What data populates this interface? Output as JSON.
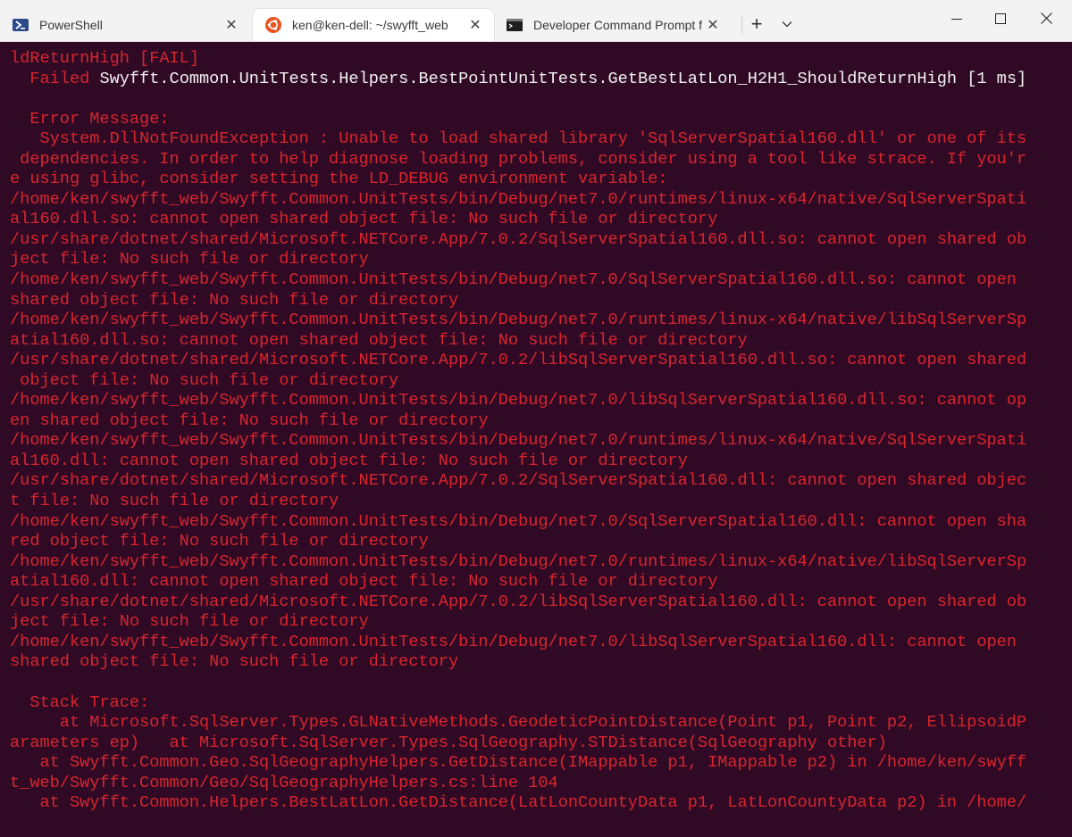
{
  "tabs": [
    {
      "label": "PowerShell",
      "icon": "powershell-icon",
      "active": false
    },
    {
      "label": "ken@ken-dell: ~/swyfft_web",
      "icon": "ubuntu-icon",
      "active": true
    },
    {
      "label": "Developer Command Prompt f",
      "icon": "cmd-icon",
      "active": false
    }
  ],
  "toolbar": {
    "new_tab": "+",
    "dropdown": "⌄"
  },
  "window": {
    "minimize": "—",
    "maximize": "☐",
    "close": "✕"
  },
  "colors": {
    "terminal_bg": "#300a24",
    "error_red": "#d9252e",
    "bright_text": "#f2f2f2",
    "ubuntu_orange": "#e95420"
  },
  "terminal": {
    "lines": [
      {
        "text": "ldReturnHigh [FAIL]"
      },
      {
        "prefix": "  Failed ",
        "text": "Swyfft.Common.UnitTests.Helpers.BestPointUnitTests.GetBestLatLon_H2H1_ShouldReturnHigh [1 ms]",
        "bright": true
      },
      {
        "text": ""
      },
      {
        "text": "  Error Message:"
      },
      {
        "text": "   System.DllNotFoundException : Unable to load shared library 'SqlServerSpatial160.dll' or one of its"
      },
      {
        "text": " dependencies. In order to help diagnose loading problems, consider using a tool like strace. If you'r"
      },
      {
        "text": "e using glibc, consider setting the LD_DEBUG environment variable:"
      },
      {
        "text": "/home/ken/swyfft_web/Swyfft.Common.UnitTests/bin/Debug/net7.0/runtimes/linux-x64/native/SqlServerSpati"
      },
      {
        "text": "al160.dll.so: cannot open shared object file: No such file or directory"
      },
      {
        "text": "/usr/share/dotnet/shared/Microsoft.NETCore.App/7.0.2/SqlServerSpatial160.dll.so: cannot open shared ob"
      },
      {
        "text": "ject file: No such file or directory"
      },
      {
        "text": "/home/ken/swyfft_web/Swyfft.Common.UnitTests/bin/Debug/net7.0/SqlServerSpatial160.dll.so: cannot open"
      },
      {
        "text": "shared object file: No such file or directory"
      },
      {
        "text": "/home/ken/swyfft_web/Swyfft.Common.UnitTests/bin/Debug/net7.0/runtimes/linux-x64/native/libSqlServerSp"
      },
      {
        "text": "atial160.dll.so: cannot open shared object file: No such file or directory"
      },
      {
        "text": "/usr/share/dotnet/shared/Microsoft.NETCore.App/7.0.2/libSqlServerSpatial160.dll.so: cannot open shared"
      },
      {
        "text": " object file: No such file or directory"
      },
      {
        "text": "/home/ken/swyfft_web/Swyfft.Common.UnitTests/bin/Debug/net7.0/libSqlServerSpatial160.dll.so: cannot op"
      },
      {
        "text": "en shared object file: No such file or directory"
      },
      {
        "text": "/home/ken/swyfft_web/Swyfft.Common.UnitTests/bin/Debug/net7.0/runtimes/linux-x64/native/SqlServerSpati"
      },
      {
        "text": "al160.dll: cannot open shared object file: No such file or directory"
      },
      {
        "text": "/usr/share/dotnet/shared/Microsoft.NETCore.App/7.0.2/SqlServerSpatial160.dll: cannot open shared objec"
      },
      {
        "text": "t file: No such file or directory"
      },
      {
        "text": "/home/ken/swyfft_web/Swyfft.Common.UnitTests/bin/Debug/net7.0/SqlServerSpatial160.dll: cannot open sha"
      },
      {
        "text": "red object file: No such file or directory"
      },
      {
        "text": "/home/ken/swyfft_web/Swyfft.Common.UnitTests/bin/Debug/net7.0/runtimes/linux-x64/native/libSqlServerSp"
      },
      {
        "text": "atial160.dll: cannot open shared object file: No such file or directory"
      },
      {
        "text": "/usr/share/dotnet/shared/Microsoft.NETCore.App/7.0.2/libSqlServerSpatial160.dll: cannot open shared ob"
      },
      {
        "text": "ject file: No such file or directory"
      },
      {
        "text": "/home/ken/swyfft_web/Swyfft.Common.UnitTests/bin/Debug/net7.0/libSqlServerSpatial160.dll: cannot open"
      },
      {
        "text": "shared object file: No such file or directory"
      },
      {
        "text": ""
      },
      {
        "text": "  Stack Trace:"
      },
      {
        "text": "     at Microsoft.SqlServer.Types.GLNativeMethods.GeodeticPointDistance(Point p1, Point p2, EllipsoidP"
      },
      {
        "text": "arameters ep)   at Microsoft.SqlServer.Types.SqlGeography.STDistance(SqlGeography other)"
      },
      {
        "text": "   at Swyfft.Common.Geo.SqlGeographyHelpers.GetDistance(IMappable p1, IMappable p2) in /home/ken/swyff"
      },
      {
        "text": "t_web/Swyfft.Common/Geo/SqlGeographyHelpers.cs:line 104"
      },
      {
        "text": "   at Swyfft.Common.Helpers.BestLatLon.GetDistance(LatLonCountyData p1, LatLonCountyData p2) in /home/"
      }
    ]
  }
}
